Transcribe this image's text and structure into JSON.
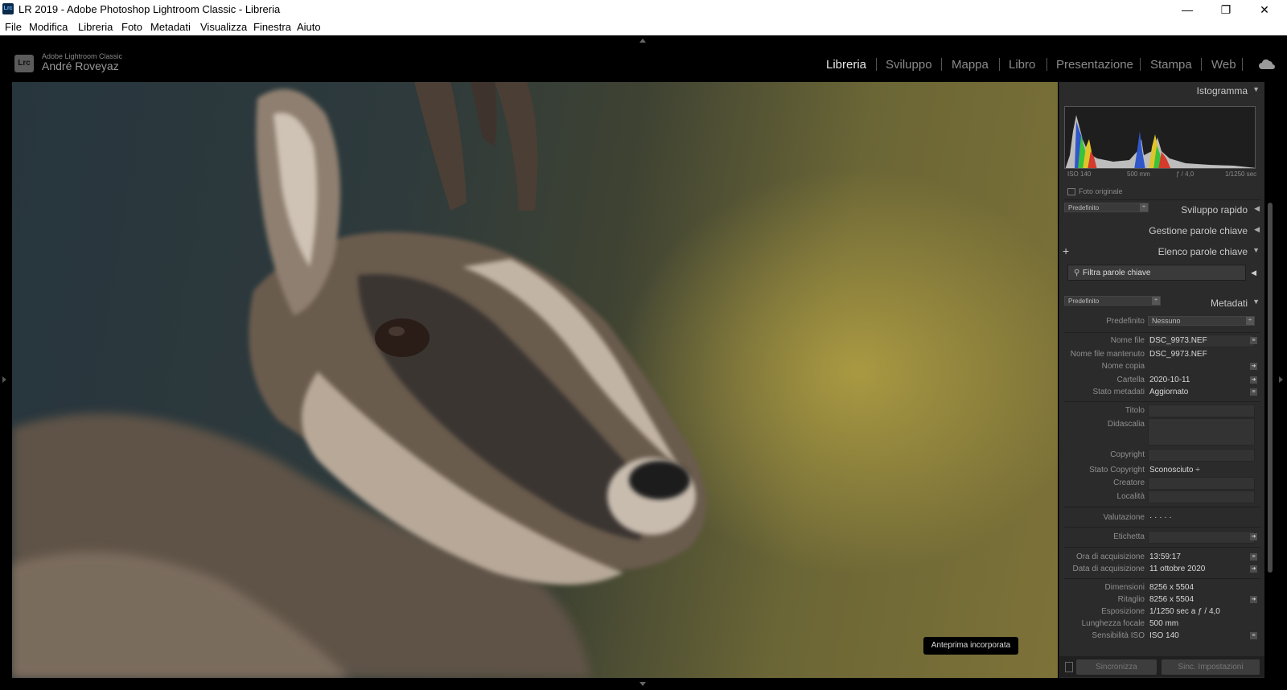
{
  "window": {
    "title": "LR 2019 - Adobe Photoshop Lightroom Classic - Libreria",
    "app_icon": "Lrc",
    "controls": {
      "minimize": "—",
      "maximize": "❐",
      "close": "✕"
    }
  },
  "menu": [
    "File",
    "Modifica",
    "Libreria",
    "Foto",
    "Metadati",
    "Visualizza",
    "Finestra",
    "Aiuto"
  ],
  "identity": {
    "logo": "Lrc",
    "product": "Adobe Lightroom Classic",
    "user": "André Roveyaz"
  },
  "modules": {
    "items": [
      "Libreria",
      "Sviluppo",
      "Mappa",
      "Libro",
      "Presentazione",
      "Stampa",
      "Web"
    ],
    "active": "Libreria",
    "cloud_icon": "cloud-icon"
  },
  "photo": {
    "badge": "Anteprima incorporata"
  },
  "panel": {
    "histogram": {
      "title": "Istogramma",
      "iso": "ISO 140",
      "focal": "500 mm",
      "aperture": "ƒ / 4,0",
      "shutter": "1/1250 sec",
      "original_label": "Foto originale"
    },
    "quick_develop": {
      "preset": "Predefinito",
      "title": "Sviluppo rapido"
    },
    "keywording": {
      "title": "Gestione parole chiave"
    },
    "keyword_list": {
      "title": "Elenco parole chiave",
      "add": "+",
      "filter_placeholder": "Filtra parole chiave"
    },
    "metadata": {
      "preset": "Predefinito",
      "title": "Metadati",
      "preset_label": "Predefinito",
      "preset_value": "Nessuno",
      "rows": {
        "file_name": {
          "k": "Nome file",
          "v": "DSC_9973.NEF"
        },
        "preserved_name": {
          "k": "Nome file mantenuto",
          "v": "DSC_9973.NEF"
        },
        "copy_name": {
          "k": "Nome copia",
          "v": ""
        },
        "folder": {
          "k": "Cartella",
          "v": "2020-10-11"
        },
        "metadata_status": {
          "k": "Stato metadati",
          "v": "Aggiornato"
        },
        "title": {
          "k": "Titolo",
          "v": ""
        },
        "caption": {
          "k": "Didascalia",
          "v": ""
        },
        "copyright": {
          "k": "Copyright",
          "v": ""
        },
        "copyright_status": {
          "k": "Stato Copyright",
          "v": "Sconosciuto ÷"
        },
        "creator": {
          "k": "Creatore",
          "v": ""
        },
        "location": {
          "k": "Località",
          "v": ""
        },
        "rating": {
          "k": "Valutazione",
          "v": "·  ·  ·  ·  ·"
        },
        "label": {
          "k": "Etichetta",
          "v": ""
        },
        "capture_time": {
          "k": "Ora di acquisizione",
          "v": "13:59:17"
        },
        "capture_date": {
          "k": "Data di acquisizione",
          "v": "11 ottobre 2020"
        },
        "dimensions": {
          "k": "Dimensioni",
          "v": "8256 x 5504"
        },
        "cropped": {
          "k": "Ritaglio",
          "v": "8256 x 5504"
        },
        "exposure": {
          "k": "Esposizione",
          "v": "1/1250 sec a ƒ / 4,0"
        },
        "focal_length": {
          "k": "Lunghezza focale",
          "v": "500 mm"
        },
        "iso": {
          "k": "Sensibilità ISO",
          "v": "ISO 140"
        }
      }
    }
  },
  "bottom": {
    "sync": "Sincronizza",
    "sync_settings": "Sinc. Impostazioni"
  }
}
